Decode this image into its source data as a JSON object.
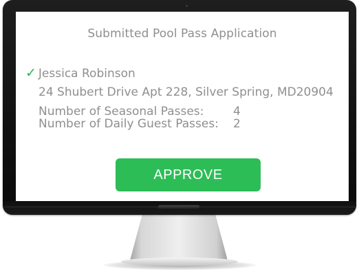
{
  "application": {
    "title": "Submitted Pool Pass Application",
    "applicant_name": "Jessica Robinson",
    "address": "24 Shubert Drive Apt 228, Silver Spring, MD20904",
    "seasonal_passes_label": "Number of Seasonal Passes:",
    "seasonal_passes_value": "4",
    "daily_guest_passes_label": "Number of Daily Guest Passes:",
    "daily_guest_passes_value": "2",
    "verified_icon": "checkmark-icon"
  },
  "actions": {
    "approve_label": "APPROVE"
  },
  "colors": {
    "accent_green": "#2dbd57",
    "check_green": "#2ab24f",
    "text_gray": "#8f8f8f",
    "bezel": "#111111"
  }
}
